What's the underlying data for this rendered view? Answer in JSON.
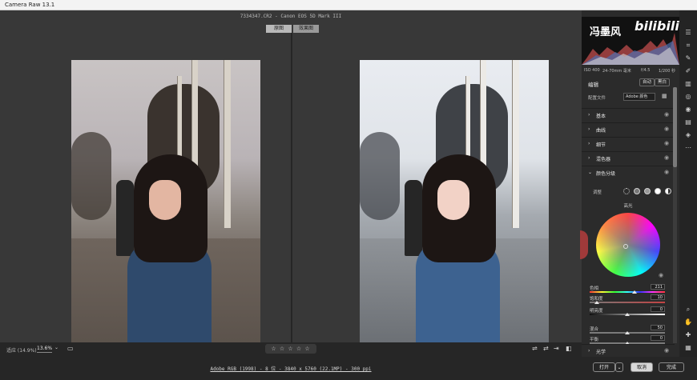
{
  "window": {
    "title": "Camera Raw 13.1"
  },
  "file": {
    "title": "7334347.CR2  -  Canon EOS 5D Mark III"
  },
  "view": {
    "before_label": "原图",
    "after_label": "效果图"
  },
  "bottom_bar": {
    "zoom_label": "适应 (14.9%)",
    "zoom_value": "13.6%",
    "rating_stars": "☆ ☆ ☆ ☆ ☆"
  },
  "footer": {
    "info_link": "Adobe RGB (1998) - 8 位 - 3840 x 5760 (22.1MP) - 300 ppi",
    "open_label": "打开",
    "cancel_label": "取消",
    "done_label": "完成"
  },
  "panel": {
    "watermark_cn": "冯墨风",
    "watermark_logo": "bilibili",
    "meta": {
      "iso": "ISO 400",
      "lens": "24-70mm 毫米",
      "aperture": "f/4.5",
      "shutter": "1/200 秒"
    },
    "edit_title": "编辑",
    "auto_label": "自动",
    "bw_label": "黑白",
    "profile_label": "配置文件",
    "profile_value": "Adobe 颜色",
    "sections": [
      "基本",
      "曲线",
      "细节",
      "混色器",
      "颜色分级"
    ],
    "bottom_section": "光学",
    "adjust_label": "调整",
    "wheel_label": "高光",
    "sliders": [
      {
        "label": "色相",
        "value": "211",
        "fraction": 0.59
      },
      {
        "label": "饱和度",
        "value": "10",
        "fraction": 0.1
      },
      {
        "label": "明亮度",
        "value": "0",
        "fraction": 0.5
      },
      {
        "label": "混合",
        "value": "50",
        "fraction": 0.5
      },
      {
        "label": "平衡",
        "value": "0",
        "fraction": 0.5
      }
    ]
  },
  "icons": {
    "chevron": "›",
    "chevron_down": "⌄",
    "eye": "◉",
    "grid": "▦"
  }
}
